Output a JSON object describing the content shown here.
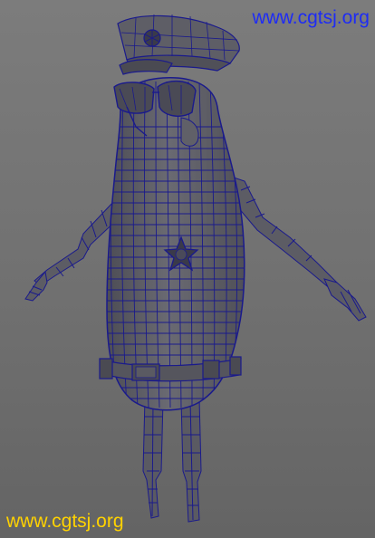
{
  "watermarks": {
    "top": {
      "text": "www.cgtsj.org",
      "color": "#1e2cf5"
    },
    "bottom": {
      "text": "www.cgtsj.org",
      "color": "#ffd200"
    }
  },
  "viewport": {
    "background": "#737373",
    "model": {
      "shading": "gray-solid-with-wireframe",
      "body_color": "#5f5f66",
      "wire_color": "#1a1a8c",
      "parts": [
        "police-cap",
        "cap-badge",
        "sunglasses",
        "nose",
        "torso",
        "star-badge",
        "belt",
        "left-arm",
        "right-arm",
        "left-leg",
        "right-leg"
      ]
    }
  }
}
